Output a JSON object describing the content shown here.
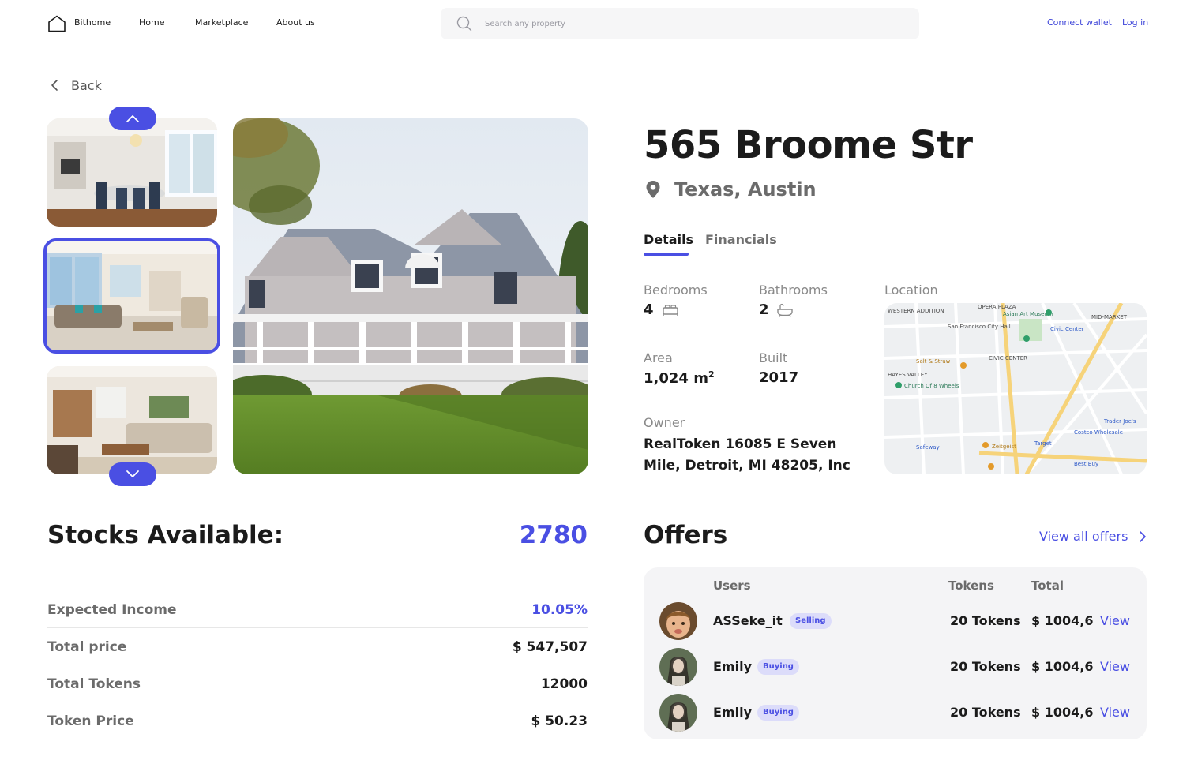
{
  "nav": {
    "brand": "Bithome",
    "links": [
      "Home",
      "Marketplace",
      "About us"
    ],
    "search_placeholder": "Search any property",
    "connect_wallet": "Connect wallet",
    "login": "Log in"
  },
  "back_label": "Back",
  "property": {
    "title": "565 Broome Str",
    "location": "Texas, Austin",
    "tabs": [
      "Details",
      "Financials"
    ],
    "active_tab": "Details",
    "bedrooms_label": "Bedrooms",
    "bedrooms": "4",
    "bathrooms_label": "Bathrooms",
    "bathrooms": "2",
    "area_label": "Area",
    "area": "1,024 m",
    "area_unit_sup": "2",
    "built_label": "Built",
    "built": "2017",
    "owner_label": "Owner",
    "owner": "RealToken 16085 E Seven Mile, Detroit, MI 48205, Inc",
    "location_label": "Location",
    "map_labels": [
      "WESTERN ADDITION",
      "OPERA PLAZA",
      "MID-MARKET",
      "Asian Art Museum",
      "San Francisco City Hall",
      "Civic Center",
      "CIVIC CENTER",
      "HAYES VALLEY",
      "Salt & Straw",
      "Church Of 8 Wheels",
      "Costco Wholesale",
      "Trader Joe's",
      "Safeway",
      "Zeitgeist",
      "Target",
      "Best Buy"
    ]
  },
  "stocks": {
    "label": "Stocks Available:",
    "value": "2780",
    "rows": [
      {
        "key": "Expected Income",
        "value": "10.05%"
      },
      {
        "key": "Total price",
        "value": "$ 547,507"
      },
      {
        "key": "Total Tokens",
        "value": "12000"
      },
      {
        "key": "Token Price",
        "value": "$ 50.23"
      }
    ]
  },
  "offers": {
    "title": "Offers",
    "view_all": "View all offers",
    "headers": {
      "users": "Users",
      "tokens": "Tokens",
      "total": "Total"
    },
    "rows": [
      {
        "user": "ASSeke_it",
        "badge": "Selling",
        "tokens": "20 Tokens",
        "total": "$ 1004,6",
        "action": "View"
      },
      {
        "user": "Emily",
        "badge": "Buying",
        "tokens": "20 Tokens",
        "total": "$ 1004,6",
        "action": "View"
      },
      {
        "user": "Emily",
        "badge": "Buying",
        "tokens": "20 Tokens",
        "total": "$ 1004,6",
        "action": "View"
      }
    ]
  },
  "colors": {
    "accent": "#4a4fe3",
    "badge_bg": "#dcdcfa",
    "offers_bg": "#f4f4f6"
  },
  "icons": [
    "home-logo-icon",
    "search-icon",
    "chevron-left-icon",
    "chevron-up-icon",
    "chevron-down-icon",
    "location-pin-icon",
    "bed-icon",
    "bathtub-icon",
    "chevron-right-icon"
  ]
}
